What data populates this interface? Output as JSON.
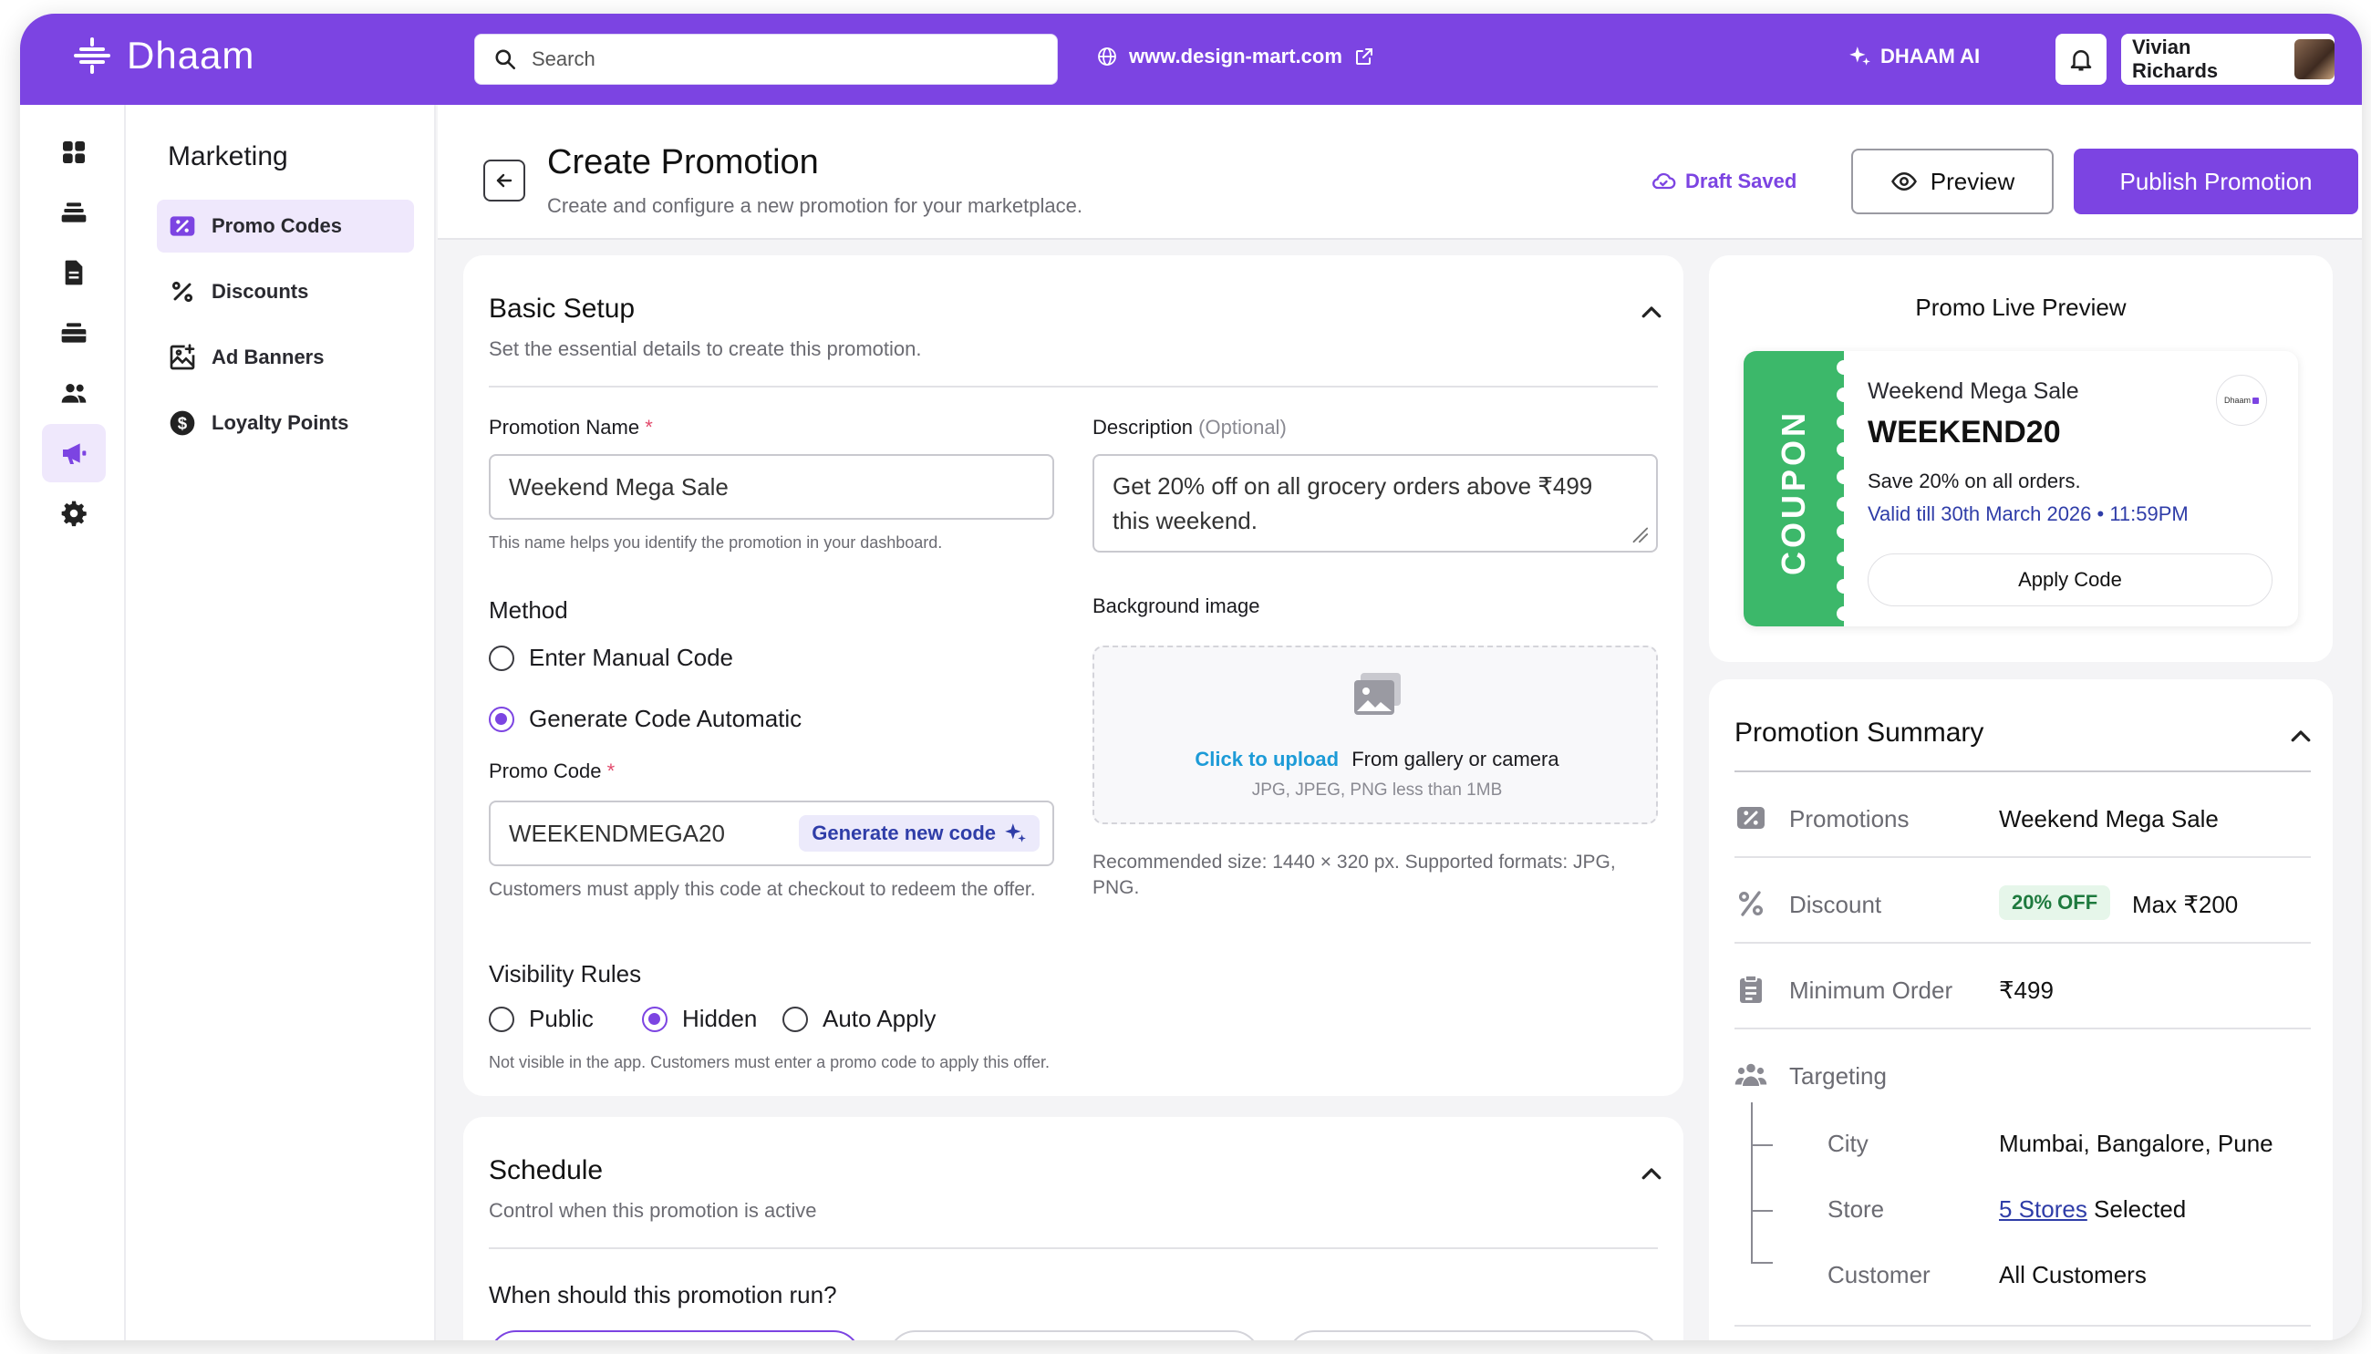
{
  "brand": {
    "name": "Dhaam",
    "accent": "#7c44e2",
    "success": "#3cb86a"
  },
  "topbar": {
    "search_placeholder": "Search",
    "site_url": "www.design-mart.com",
    "ai_label": "DHAAM AI",
    "user_name": "Vivian Richards"
  },
  "rail_icons": [
    "grid-icon",
    "layers-icon",
    "document-icon",
    "stack-icon",
    "users-icon",
    "megaphone-icon",
    "gear-icon"
  ],
  "sidebar": {
    "title": "Marketing",
    "items": [
      {
        "label": "Promo Codes",
        "icon": "promo-tag-icon",
        "active": true
      },
      {
        "label": "Discounts",
        "icon": "percent-icon"
      },
      {
        "label": "Ad Banners",
        "icon": "image-add-icon"
      },
      {
        "label": "Loyalty Points",
        "icon": "dollar-coin-icon"
      }
    ]
  },
  "header": {
    "title": "Create Promotion",
    "subtitle": "Create and configure a new promotion for your marketplace.",
    "draft_status": "Draft Saved",
    "preview_label": "Preview",
    "publish_label": "Publish Promotion"
  },
  "basic": {
    "title": "Basic Setup",
    "subtitle": "Set the essential details to create this promotion.",
    "name_label": "Promotion Name",
    "required_mark": "*",
    "name_value": "Weekend Mega Sale",
    "name_help": "This name helps you identify the promotion in your dashboard.",
    "desc_label": "Description",
    "desc_optional": "(Optional)",
    "desc_value": "Get 20% off on all grocery orders above ₹499 this weekend.",
    "method_title": "Method",
    "method_manual": "Enter Manual Code",
    "method_auto": "Generate Code Automatic",
    "method_selected": "auto",
    "bg_label": "Background image",
    "upload_link": "Click to upload",
    "upload_text": "From gallery or camera",
    "upload_formats": "JPG, JPEG, PNG less than 1MB",
    "upload_help": "Recommended size: 1440 × 320 px. Supported formats: JPG, PNG.",
    "code_label": "Promo Code",
    "code_value": "WEEKENDMEGA20",
    "generate_label": "Generate new code",
    "code_help": "Customers must apply this code at checkout to redeem the offer.",
    "visibility_title": "Visibility Rules",
    "vis_public": "Public",
    "vis_hidden": "Hidden",
    "vis_auto": "Auto Apply",
    "vis_selected": "hidden",
    "vis_help": "Not visible in the app. Customers must enter a promo code to apply this offer."
  },
  "schedule": {
    "title": "Schedule",
    "subtitle": "Control when this promotion is active",
    "question": "When should this promotion run?"
  },
  "preview": {
    "title": "Promo Live Preview",
    "coupon_word": "COUPON",
    "name": "Weekend Mega Sale",
    "code": "WEEKEND20",
    "badge": "Dhaam",
    "desc": "Save 20% on all orders.",
    "validity": "Valid till 30th March 2026 • 11:59PM",
    "apply_label": "Apply Code"
  },
  "summary": {
    "title": "Promotion Summary",
    "promotions_label": "Promotions",
    "promotions_value": "Weekend Mega Sale",
    "discount_label": "Discount",
    "discount_pill": "20% OFF",
    "discount_max": "Max ₹200",
    "min_order_label": "Minimum Order",
    "min_order_value": "₹499",
    "targeting_label": "Targeting",
    "city_label": "City",
    "city_value": "Mumbai, Bangalore, Pune",
    "store_label": "Store",
    "store_link": "5 Stores",
    "store_suffix": " Selected",
    "customer_label": "Customer",
    "customer_value": "All Customers"
  }
}
